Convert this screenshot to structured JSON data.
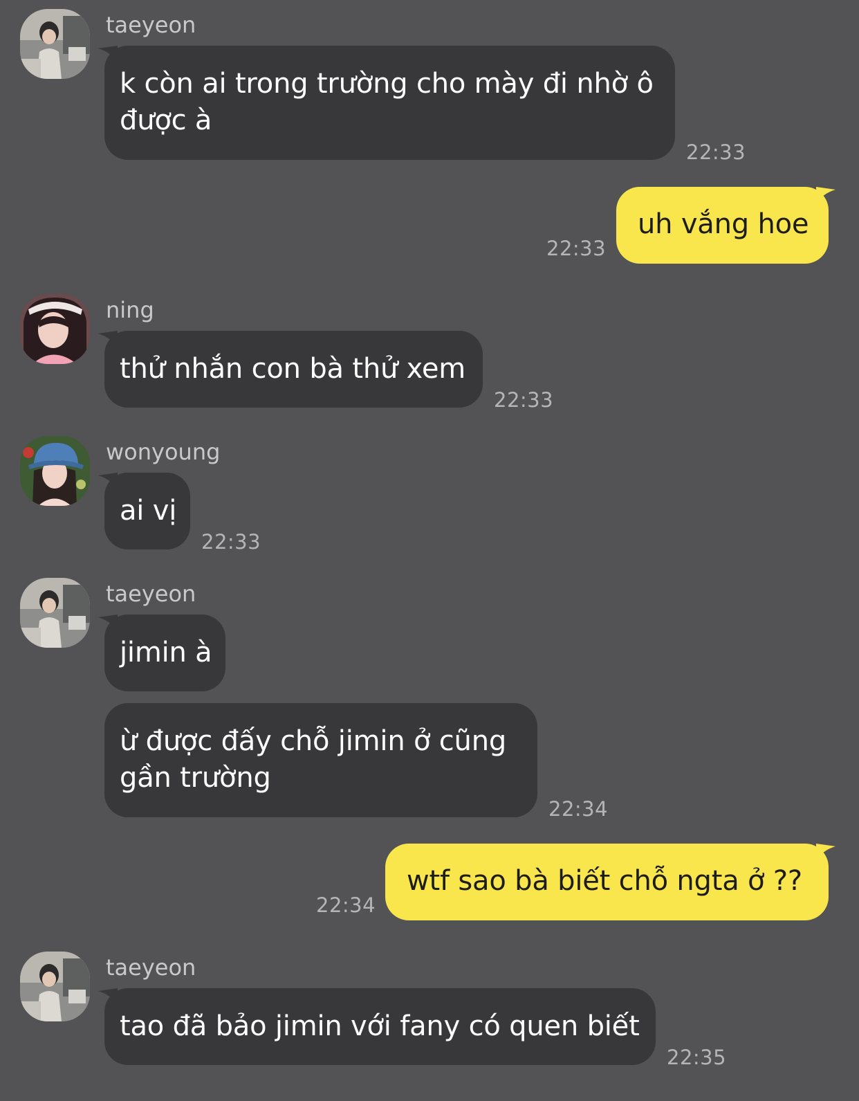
{
  "colors": {
    "background": "#535254",
    "incoming_bubble": "#38383a",
    "outgoing_bubble": "#f9e54c",
    "timestamp": "#b5b4b7",
    "sender_name": "#c9c8cb"
  },
  "messages": [
    {
      "sender": "taeyeon",
      "avatar": "taeyeon-avatar-icon",
      "lines": [
        "k còn ai trong trường cho mày đi nhờ ô",
        "được à"
      ],
      "time": "22:33",
      "direction": "incoming"
    },
    {
      "sender": "",
      "lines": [
        "uh vắng hoe"
      ],
      "time": "22:33",
      "direction": "outgoing"
    },
    {
      "sender": "ning",
      "avatar": "ning-avatar-icon",
      "lines": [
        "thử nhắn con bà thử xem"
      ],
      "time": "22:33",
      "direction": "incoming"
    },
    {
      "sender": "wonyoung",
      "avatar": "wonyoung-avatar-icon",
      "lines": [
        "ai vị"
      ],
      "time": "22:33",
      "direction": "incoming"
    },
    {
      "sender": "taeyeon",
      "avatar": "taeyeon-avatar-icon",
      "lines": [
        "jimin à"
      ],
      "time": "",
      "direction": "incoming"
    },
    {
      "sender": "",
      "lines": [
        "ừ được đấy chỗ jimin ở cũng",
        "gần trường"
      ],
      "time": "22:34",
      "direction": "incoming"
    },
    {
      "sender": "",
      "lines": [
        "wtf sao bà biết chỗ ngta ở ??"
      ],
      "time": "22:34",
      "direction": "outgoing"
    },
    {
      "sender": "taeyeon",
      "avatar": "taeyeon-avatar-icon",
      "lines": [
        "tao đã bảo jimin với fany có quen biết"
      ],
      "time": "22:35",
      "direction": "incoming"
    }
  ]
}
